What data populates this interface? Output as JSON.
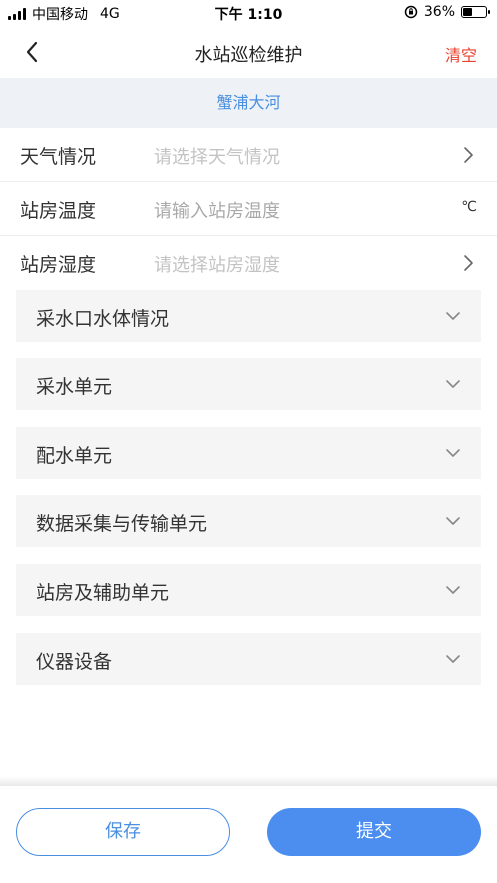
{
  "status_bar": {
    "carrier": "中国移动",
    "network": "4G",
    "time": "下午 1:10",
    "battery_percent": "36%",
    "battery_level": 0.36
  },
  "nav": {
    "back_icon": "chevron-left-icon",
    "title": "水站巡检维护",
    "clear_label": "清空"
  },
  "station": {
    "name": "蟹浦大河"
  },
  "form": {
    "weather": {
      "label": "天气情况",
      "placeholder": "请选择天气情况"
    },
    "room_temp": {
      "label": "站房温度",
      "placeholder": "请输入站房温度",
      "unit": "℃"
    },
    "room_humidity": {
      "label": "站房湿度",
      "placeholder": "请选择站房湿度"
    }
  },
  "sections": [
    {
      "label": "采水口水体情况"
    },
    {
      "label": "采水单元"
    },
    {
      "label": "配水单元"
    },
    {
      "label": "数据采集与传输单元"
    },
    {
      "label": "站房及辅助单元"
    },
    {
      "label": "仪器设备"
    }
  ],
  "actions": {
    "save_label": "保存",
    "submit_label": "提交"
  },
  "colors": {
    "accent": "#4b8ef0",
    "danger": "#e8412c",
    "banner_bg": "#eef2f7",
    "section_bg": "#f5f5f5"
  }
}
